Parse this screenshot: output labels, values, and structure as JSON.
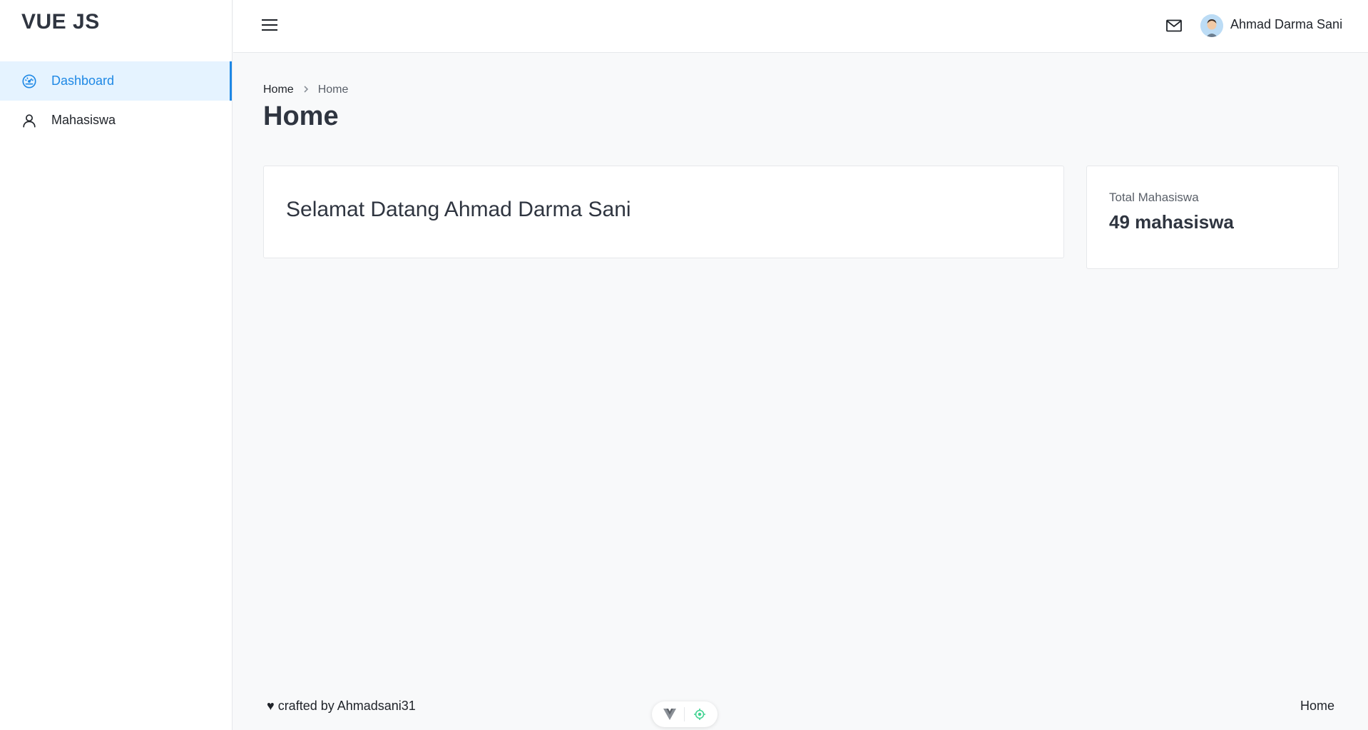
{
  "brand": "VUE JS",
  "sidebar": {
    "items": [
      {
        "label": "Dashboard",
        "icon": "dashboard-gauge-icon",
        "active": true
      },
      {
        "label": "Mahasiswa",
        "icon": "user-icon",
        "active": false
      }
    ]
  },
  "header": {
    "menu_icon": "hamburger-icon",
    "mail_icon": "mail-icon",
    "user_name": "Ahmad Darma Sani"
  },
  "breadcrumb": {
    "items": [
      "Home",
      "Home"
    ]
  },
  "page": {
    "title": "Home"
  },
  "welcome": {
    "text": "Selamat Datang Ahmad Darma Sani"
  },
  "stat": {
    "label": "Total Mahasiswa",
    "value": "49 mahasiswa"
  },
  "footer": {
    "credit": "♥ crafted by Ahmadsani31",
    "right_link": "Home"
  },
  "devtools": {
    "icons": [
      "vue-logo-icon",
      "inspect-target-icon"
    ]
  },
  "colors": {
    "accent": "#1e88e5",
    "active_bg": "#e5f3ff",
    "background": "#f8f9fa",
    "devtools_green": "#42d392"
  }
}
